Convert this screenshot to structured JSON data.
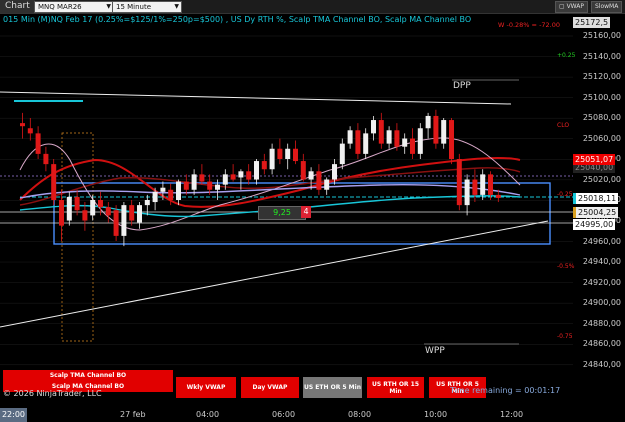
{
  "toolbar": {
    "chart_label": "Chart",
    "instrument": "MNQ MAR26",
    "interval": "15 Minute",
    "btn1": "▢ VWAP",
    "btn2": "SlowMA"
  },
  "chart_info": "015 Min (M)NQ Feb 17  (0.25%=$125/1%=250p=$500) , US Dy RTH %, Scalp TMA Channel BO, Scalp MA Channel BO",
  "change_text": "W -0.28% = -72.00",
  "price_axis": [
    "25160,00",
    "25140,00",
    "25120,00",
    "25100,00",
    "25080,00",
    "25060,00",
    "25040,00",
    "25020,00",
    "25000,00",
    "24980,00",
    "24960,00",
    "24940,00",
    "24920,00",
    "24900,00",
    "24880,00",
    "24860,00",
    "24840,00"
  ],
  "price_tags": {
    "top": "25172,5",
    "last": "25051,07",
    "hidden": "25040,00",
    "t1": "25018,11",
    "t2": "25004,25",
    "t3": "24995,00"
  },
  "annotations": {
    "pct_025": "+0.25",
    "clo": "CLO",
    "neg_025": "-0.25",
    "neg_05": "-0.5%",
    "neg_075": "-0.75"
  },
  "levels": {
    "dpp": "DPP",
    "wpp": "WPP"
  },
  "box_label": "9,25",
  "box_num": "4",
  "x_axis": {
    "current": "22:00",
    "labels": [
      "27 feb",
      "04:00",
      "06:00",
      "08:00",
      "10:00",
      "12:00"
    ]
  },
  "buttons": {
    "tma": "Scalp TMA Channel BO",
    "ma": "Scalp MA Channel BO",
    "wkly_vwap": "Wkly VWAP",
    "day_vwap": "Day VWAP",
    "eth": "US ETH OR 5 Min",
    "rth15": "US RTH OR 15 Min",
    "rth5": "US RTH OR 5 Min"
  },
  "copyright": "© 2026 NinjaTrader, LLC",
  "time_remaining": "Time remaining = 00:01:17",
  "colors": {
    "bull": "#f0f0f0",
    "bear": "#e01818",
    "channel_blue": "#4a8fff",
    "cyan": "#18c6d8"
  },
  "chart_data": {
    "type": "candlestick",
    "ylim": [
      24830,
      25180
    ],
    "candles": [
      [
        25075,
        25085,
        25060,
        25072
      ],
      [
        25070,
        25080,
        25058,
        25065
      ],
      [
        25065,
        25072,
        25040,
        25045
      ],
      [
        25045,
        25052,
        25028,
        25035
      ],
      [
        25035,
        25040,
        24995,
        25000
      ],
      [
        25000,
        25010,
        24960,
        24975
      ],
      [
        24980,
        25008,
        24975,
        25003
      ],
      [
        25003,
        25010,
        24985,
        24990
      ],
      [
        24990,
        24998,
        24970,
        24980
      ],
      [
        24985,
        25005,
        24980,
        25000
      ],
      [
        25000,
        25008,
        24985,
        24993
      ],
      [
        24993,
        24998,
        24978,
        24985
      ],
      [
        24990,
        24995,
        24960,
        24965
      ],
      [
        24965,
        24998,
        24955,
        24995
      ],
      [
        24995,
        25000,
        24975,
        24980
      ],
      [
        24978,
        24998,
        24972,
        24995
      ],
      [
        24995,
        25005,
        24985,
        25000
      ],
      [
        24998,
        25012,
        24990,
        25008
      ],
      [
        25008,
        25018,
        25000,
        25012
      ],
      [
        25010,
        25016,
        24995,
        25000
      ],
      [
        25000,
        25020,
        24995,
        25018
      ],
      [
        25018,
        25025,
        25005,
        25010
      ],
      [
        25010,
        25030,
        25005,
        25025
      ],
      [
        25025,
        25035,
        25015,
        25018
      ],
      [
        25018,
        25025,
        25005,
        25010
      ],
      [
        25010,
        25020,
        25000,
        25015
      ],
      [
        25015,
        25030,
        25010,
        25025
      ],
      [
        25025,
        25035,
        25018,
        25020
      ],
      [
        25022,
        25030,
        25010,
        25028
      ],
      [
        25028,
        25035,
        25015,
        25020
      ],
      [
        25020,
        25040,
        25015,
        25038
      ],
      [
        25038,
        25045,
        25025,
        25030
      ],
      [
        25030,
        25055,
        25025,
        25050
      ],
      [
        25050,
        25060,
        25035,
        25040
      ],
      [
        25040,
        25055,
        25030,
        25050
      ],
      [
        25050,
        25058,
        25035,
        25038
      ],
      [
        25038,
        25045,
        25018,
        25020
      ],
      [
        25020,
        25032,
        25010,
        25028
      ],
      [
        25028,
        25035,
        25005,
        25010
      ],
      [
        25010,
        25022,
        25005,
        25020
      ],
      [
        25020,
        25040,
        25015,
        25035
      ],
      [
        25035,
        25060,
        25030,
        25055
      ],
      [
        25055,
        25072,
        25050,
        25068
      ],
      [
        25068,
        25075,
        25040,
        25045
      ],
      [
        25045,
        25070,
        25040,
        25065
      ],
      [
        25065,
        25082,
        25058,
        25078
      ],
      [
        25078,
        25085,
        25050,
        25055
      ],
      [
        25055,
        25072,
        25050,
        25068
      ],
      [
        25068,
        25075,
        25048,
        25052
      ],
      [
        25052,
        25065,
        25045,
        25060
      ],
      [
        25060,
        25070,
        25040,
        25045
      ],
      [
        25045,
        25075,
        25040,
        25070
      ],
      [
        25070,
        25085,
        25060,
        25082
      ],
      [
        25082,
        25088,
        25050,
        25055
      ],
      [
        25055,
        25080,
        25050,
        25078
      ],
      [
        25078,
        25080,
        25035,
        25040
      ],
      [
        25040,
        25045,
        24990,
        24995
      ],
      [
        24995,
        25025,
        24985,
        25020
      ],
      [
        25020,
        25030,
        24998,
        25005
      ],
      [
        25005,
        25030,
        25000,
        25025
      ],
      [
        25025,
        25028,
        25000,
        25005
      ],
      [
        25005,
        25010,
        24998,
        25002
      ]
    ]
  }
}
